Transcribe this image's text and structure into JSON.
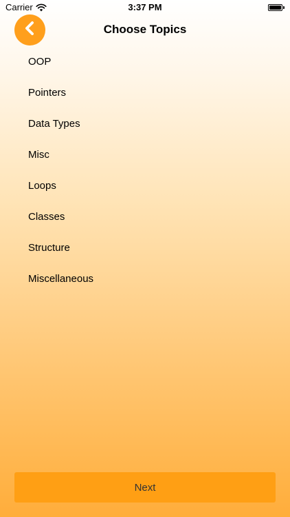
{
  "status_bar": {
    "carrier": "Carrier",
    "time": "3:37 PM",
    "wifi_icon": "wifi-icon",
    "battery_icon": "battery-icon"
  },
  "nav": {
    "title": "Choose Topics",
    "back_icon": "chevron-left-icon"
  },
  "topics": [
    {
      "label": "OOP"
    },
    {
      "label": "Pointers"
    },
    {
      "label": "Data Types"
    },
    {
      "label": "Misc"
    },
    {
      "label": "Loops"
    },
    {
      "label": "Classes"
    },
    {
      "label": "Structure"
    },
    {
      "label": "Miscellaneous"
    }
  ],
  "next_button": {
    "label": "Next"
  },
  "colors": {
    "accent": "#ff9f1c",
    "button": "#ff9f14"
  }
}
